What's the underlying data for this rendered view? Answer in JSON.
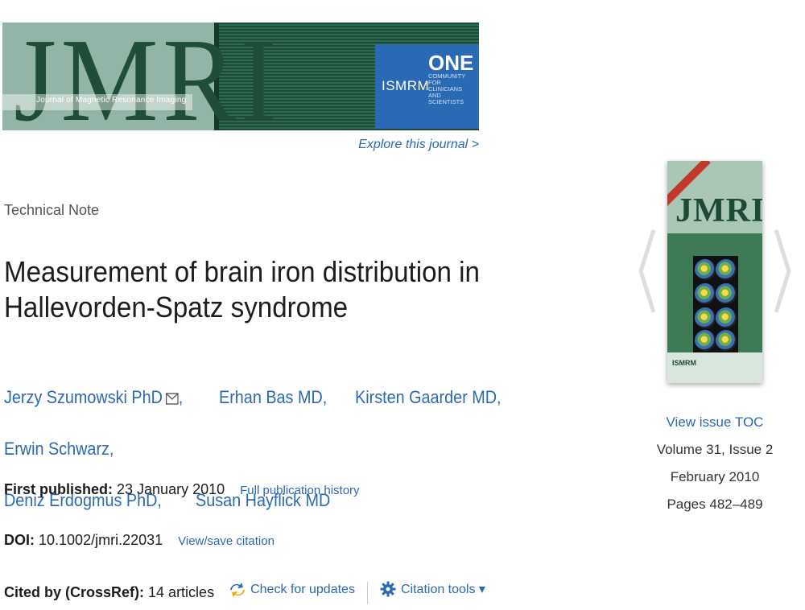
{
  "banner": {
    "logo": "JMRI",
    "subtitle": "Journal of Magnetic Resonance Imaging",
    "ismrm": "ISMRM",
    "one": "ONE",
    "one_lines": [
      "COMMUNITY",
      "FOR CLINICIANS",
      "AND SCIENTISTS"
    ]
  },
  "explore_link": "Explore this journal >",
  "article": {
    "type": "Technical Note",
    "title_line1": "Measurement of brain iron distribution in",
    "title_line2": "Hallevorden-Spatz syndrome",
    "authors": [
      "Jerzy Szumowski PhD",
      "Erhan Bas MD,",
      "Kirsten Gaarder MD,",
      "Erwin Schwarz,",
      "Deniz Erdogmus PhD,",
      "Susan Hayflick MD"
    ],
    "first_author_suffix": ","
  },
  "meta": {
    "first_published_label": "First published:",
    "first_published_value": "23 January 2010",
    "full_history_link": "Full publication history",
    "doi_label": "DOI:",
    "doi_value": "10.1002/jmri.22031",
    "view_save_link": "View/save citation",
    "cited_label": "Cited by (CrossRef):",
    "cited_value": "14 articles",
    "check_updates": "Check for updates",
    "citation_tools": "Citation tools ▾"
  },
  "issue": {
    "cover_title": "JMRI",
    "cover_ismrm": "ISMRM",
    "view_toc": "View  issue TOC",
    "volume": "Volume 31, Issue 2",
    "date": "February 2010",
    "pages": "Pages 482–489"
  },
  "colors": {
    "link": "#2a69b3",
    "banner_green": "#93b5a7",
    "banner_dark": "#1d4a36",
    "ismrm_blue": "#2a69b3"
  }
}
